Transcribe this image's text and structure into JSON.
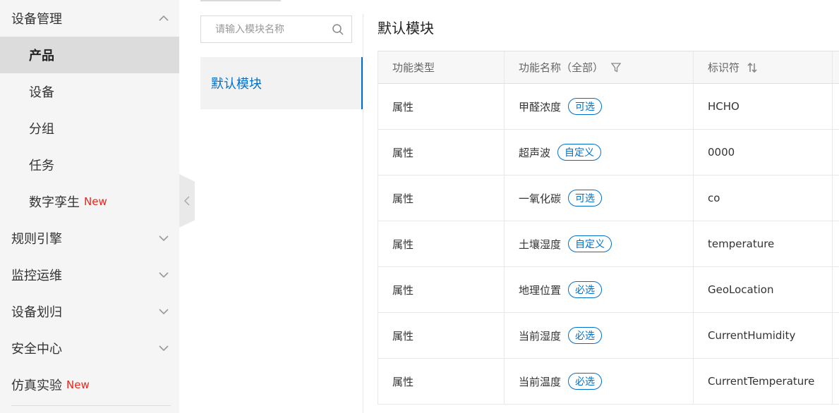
{
  "sidebar": {
    "device_management": {
      "label": "设备管理",
      "items": [
        "产品",
        "设备",
        "分组",
        "任务"
      ],
      "digital_twin": {
        "label": "数字孪生",
        "badge": "New"
      }
    },
    "rules_engine": "规则引擎",
    "monitoring_ops": "监控运维",
    "device_assign": "设备划归",
    "security_center": "安全中心",
    "simulation_lab": {
      "label": "仿真实验",
      "badge": "New"
    }
  },
  "module_panel": {
    "search_placeholder": "请输入模块名称",
    "items": [
      "默认模块"
    ]
  },
  "content": {
    "title": "默认模块",
    "columns": {
      "type": "功能类型",
      "name": "功能名称（全部）",
      "identifier": "标识符"
    },
    "rows": [
      {
        "type": "属性",
        "name": "甲醛浓度",
        "tag": "可选",
        "identifier": "HCHO"
      },
      {
        "type": "属性",
        "name": "超声波",
        "tag": "自定义",
        "identifier": "0000"
      },
      {
        "type": "属性",
        "name": "一氧化碳",
        "tag": "可选",
        "identifier": "co"
      },
      {
        "type": "属性",
        "name": "土壤湿度",
        "tag": "自定义",
        "identifier": "temperature"
      },
      {
        "type": "属性",
        "name": "地理位置",
        "tag": "必选",
        "identifier": "GeoLocation"
      },
      {
        "type": "属性",
        "name": "当前湿度",
        "tag": "必选",
        "identifier": "CurrentHumidity"
      },
      {
        "type": "属性",
        "name": "当前温度",
        "tag": "必选",
        "identifier": "CurrentTemperature"
      }
    ]
  },
  "colors": {
    "accent": "#0070cc",
    "badge_new": "#e8261c",
    "sidebar_bg": "#f5f5f5",
    "active_item_bg": "#dcdcdc"
  },
  "icons": {
    "expand_up": "chevron-up-icon",
    "expand_down": "chevron-down-icon",
    "collapse": "chevron-left-icon",
    "search": "search-icon",
    "filter": "filter-icon",
    "sort": "sort-icon"
  }
}
